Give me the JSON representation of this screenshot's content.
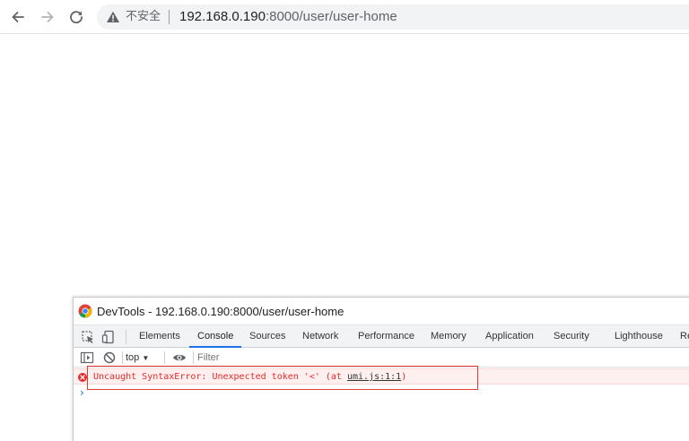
{
  "browser": {
    "security_label": "不安全",
    "url_host": "192.168.0.190",
    "url_path": ":8000/user/user-home"
  },
  "devtools": {
    "title": "DevTools - 192.168.0.190:8000/user/user-home",
    "tabs": [
      {
        "label": "Elements"
      },
      {
        "label": "Console",
        "active": true
      },
      {
        "label": "Sources"
      },
      {
        "label": "Network"
      },
      {
        "label": "Performance"
      },
      {
        "label": "Memory"
      },
      {
        "label": "Application"
      },
      {
        "label": "Security"
      },
      {
        "label": "Lighthouse"
      },
      {
        "label": "Re"
      }
    ],
    "console_bar": {
      "context": "top",
      "filter_placeholder": "Filter"
    },
    "messages": [
      {
        "level": "error",
        "text": "Uncaught SyntaxError: Unexpected token '<' (at ",
        "link": "umi.js:1:1",
        "suffix": ")"
      }
    ],
    "colors": {
      "accent": "#1a73e8",
      "error": "#e42a2a",
      "error_background": "#fff0f0"
    }
  }
}
